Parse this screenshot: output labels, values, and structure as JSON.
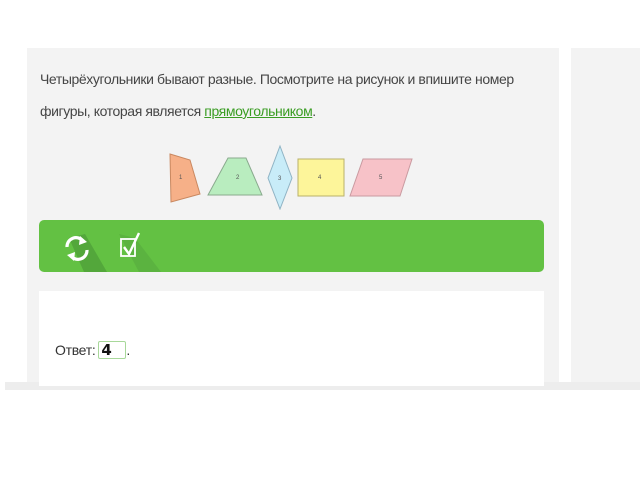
{
  "task": {
    "text_before": "Четырёхугольники бывают разные. Посмотрите на рисунок и впишите номер фигуры, которая является ",
    "link_text": "прямоугольником",
    "text_after": "."
  },
  "figures": [
    {
      "number": "1",
      "color": "#f6b088"
    },
    {
      "number": "2",
      "color": "#b9edbf"
    },
    {
      "number": "3",
      "color": "#c8ecf8"
    },
    {
      "number": "4",
      "color": "#fdf59a"
    },
    {
      "number": "5",
      "color": "#f7c2c8"
    }
  ],
  "toolbar": {
    "refresh_icon": "refresh-icon",
    "check_icon": "checkbox-check-icon",
    "color": "#63c143"
  },
  "answer": {
    "label": "Ответ:",
    "value": "4",
    "suffix": "."
  }
}
